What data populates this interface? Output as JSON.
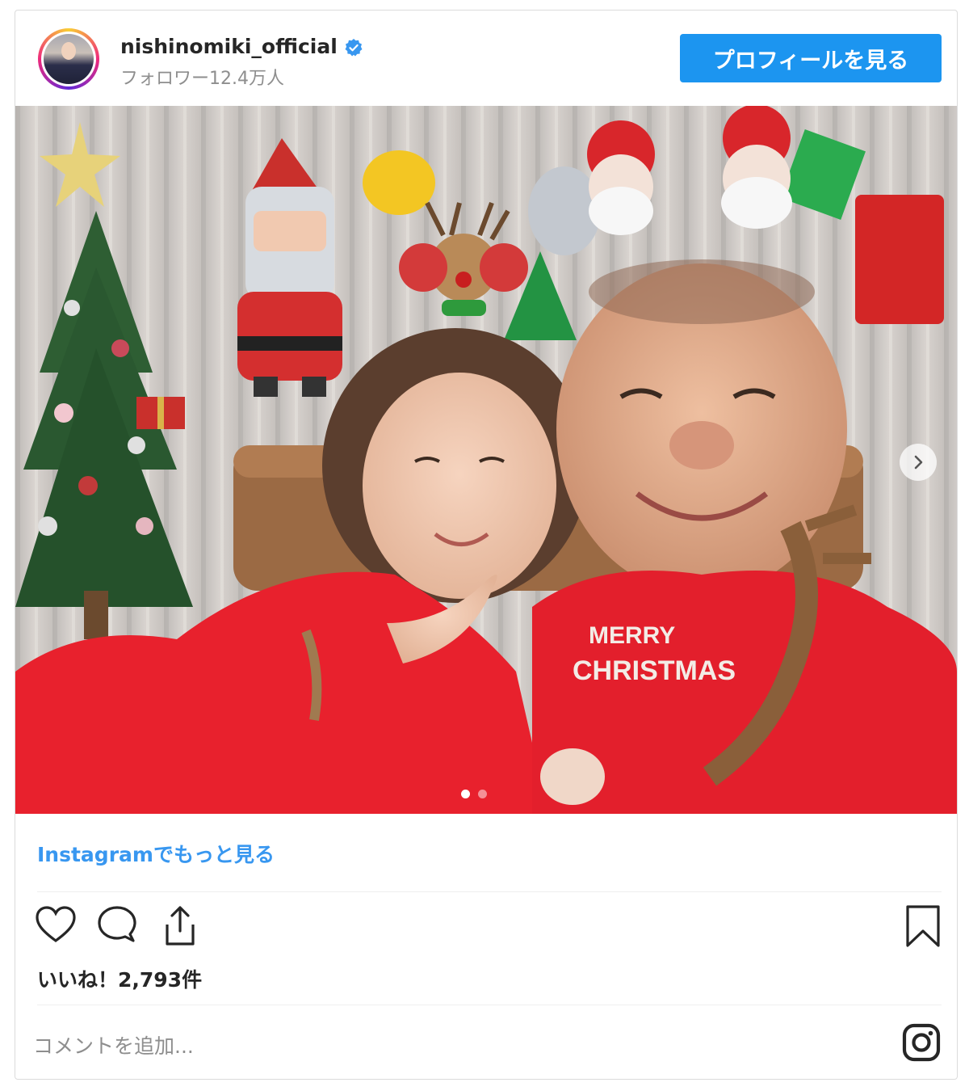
{
  "post": {
    "username": "nishinomiki_official",
    "followers": "フォロワー12.4万人",
    "profile_button": "プロフィールを見る",
    "more_link": "Instagramでもっと見る",
    "likes": "いいね！2,793件",
    "comment_placeholder": "コメントを追加...",
    "carousel": {
      "slides": 2,
      "active": 1
    }
  },
  "photo": {
    "description_icons": [
      "christmas-tree",
      "santa-balloon",
      "reindeer-headband",
      "santa-headband"
    ],
    "sweater_text": "MERRY CHRISTMAS"
  },
  "colors": {
    "accent": "#1c95f0",
    "link": "#3897f0",
    "verified": "#3897f0",
    "sweater_red": "#e8212d"
  },
  "icons": [
    "verified-badge-icon",
    "heart-icon",
    "comment-icon",
    "share-icon",
    "bookmark-icon",
    "instagram-icon",
    "chevron-right-icon"
  ]
}
